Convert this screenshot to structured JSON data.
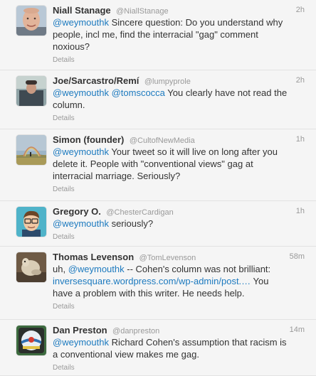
{
  "tweets": [
    {
      "name": "Niall Stanage",
      "handle": "@NiallStanage",
      "time": "2h",
      "lines": [
        [
          {
            "t": "@weymouthk",
            "link": true
          },
          {
            "t": " Sincere question: Do you understand why"
          }
        ],
        [
          {
            "t": "people, incl me, find the interracial \"gag\" comment"
          }
        ],
        [
          {
            "t": "noxious?"
          }
        ]
      ],
      "details": "Details"
    },
    {
      "name": "Joe/Sarcastro/Remí",
      "handle": "@lumpyprole",
      "time": "2h",
      "lines": [
        [
          {
            "t": "@weymouthk",
            "link": true
          },
          {
            "t": " "
          },
          {
            "t": "@tomscocca",
            "link": true
          },
          {
            "t": " You clearly have not read the"
          }
        ],
        [
          {
            "t": "column."
          }
        ]
      ],
      "details": "Details"
    },
    {
      "name": "Simon (founder)",
      "handle": "@CultofNewMedia",
      "time": "1h",
      "lines": [
        [
          {
            "t": "@weymouthk",
            "link": true
          },
          {
            "t": " Your tweet so it will live on long after you"
          }
        ],
        [
          {
            "t": "delete it. People with \"conventional views\" gag at"
          }
        ],
        [
          {
            "t": "interracial marriage. Seriously?"
          }
        ]
      ],
      "details": "Details"
    },
    {
      "name": "Gregory O.",
      "handle": "@ChesterCardigan",
      "time": "1h",
      "lines": [
        [
          {
            "t": "@weymouthk",
            "link": true
          },
          {
            "t": " seriously?"
          }
        ]
      ],
      "details": "Details"
    },
    {
      "name": "Thomas Levenson",
      "handle": "@TomLevenson",
      "time": "58m",
      "lines": [
        [
          {
            "t": "uh, "
          },
          {
            "t": "@weymouthk",
            "link": true
          },
          {
            "t": " -- Cohen's column was not brilliant:"
          }
        ],
        [
          {
            "t": "inversesquare.wordpress.com/wp-admin/post.…",
            "link": true
          },
          {
            "t": " You"
          }
        ],
        [
          {
            "t": "have a problem with this writer. He needs help."
          }
        ]
      ],
      "details": "Details"
    },
    {
      "name": "Dan Preston",
      "handle": "@danpreston",
      "time": "14m",
      "lines": [
        [
          {
            "t": "@weymouthk",
            "link": true
          },
          {
            "t": " Richard Cohen's assumption that racism is"
          }
        ],
        [
          {
            "t": "a conventional view makes me gag."
          }
        ]
      ],
      "details": "Details"
    }
  ]
}
